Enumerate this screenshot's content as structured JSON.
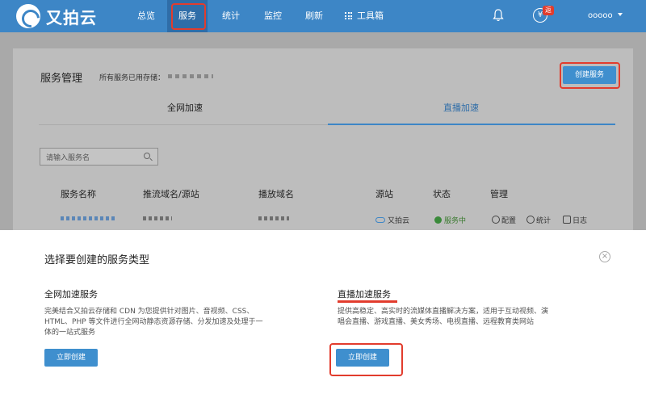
{
  "brand": {
    "name": "又拍云"
  },
  "nav": {
    "items": [
      {
        "label": "总览"
      },
      {
        "label": "服务"
      },
      {
        "label": "统计"
      },
      {
        "label": "监控"
      },
      {
        "label": "刷新"
      },
      {
        "label": "工具箱"
      }
    ],
    "badge": "返",
    "yen_symbol": "¥",
    "user": "ooooo"
  },
  "page": {
    "title": "服务管理",
    "storage_label": "所有服务已用存储：",
    "create_button": "创建服务",
    "tabs": [
      {
        "label": "全网加速",
        "active": false
      },
      {
        "label": "直播加速",
        "active": true
      }
    ],
    "search_placeholder": "请输入服务名",
    "table": {
      "headers": [
        "服务名称",
        "推流域名/源站",
        "播放域名",
        "源站",
        "状态",
        "管理"
      ],
      "row": {
        "origin": "又拍云",
        "status": "服务中",
        "actions": [
          "配置",
          "统计",
          "日志"
        ]
      }
    }
  },
  "modal": {
    "title": "选择要创建的服务类型",
    "close_symbol": "×",
    "options": [
      {
        "title": "全网加速服务",
        "desc_lines": [
          "完美结合又拍云存储和 CDN 为您提供针对图片、音视频、CSS、",
          "HTML、PHP 等文件进行全网动静态资源存储、分发加速及处理于一",
          "体的一站式服务"
        ],
        "button": "立即创建"
      },
      {
        "title": "直播加速服务",
        "desc_lines": [
          "提供高稳定、高实时的流媒体直播解决方案，适用于互动视频、演",
          "唱会直播、游戏直播、美女秀场、电视直播、远程教育类网站"
        ],
        "button": "立即创建"
      }
    ]
  },
  "colors": {
    "nav_bg": "#3d86c6",
    "primary_button": "#3f8fce",
    "highlight": "#e23c2d",
    "status_ok": "#3a8a3a"
  }
}
